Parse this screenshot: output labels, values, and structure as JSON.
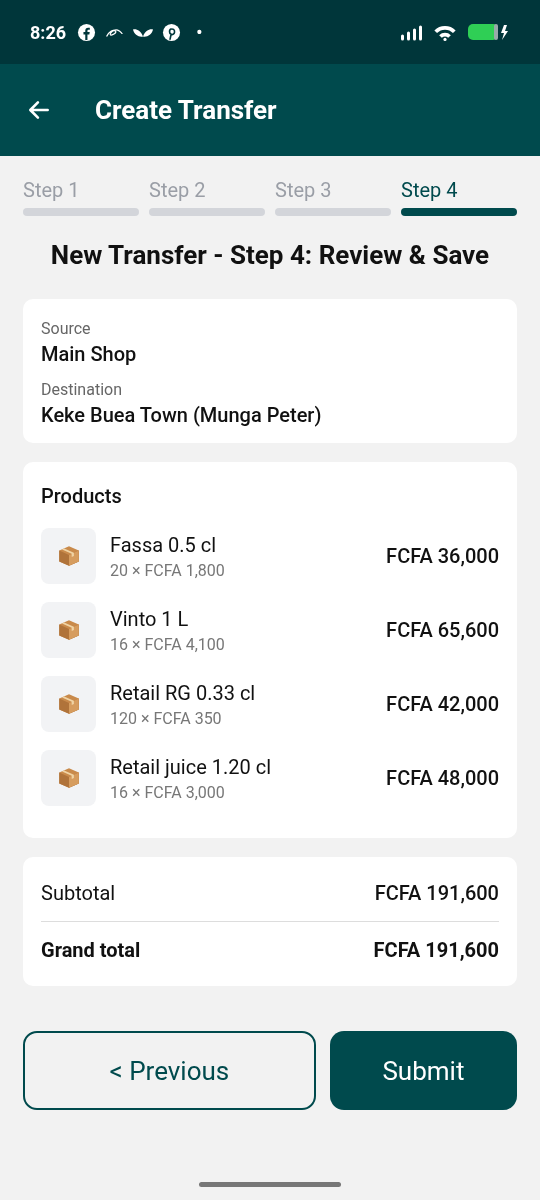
{
  "status_bar": {
    "time": "8:26",
    "notification_dot": "•"
  },
  "app_bar": {
    "title": "Create Transfer"
  },
  "steps": [
    {
      "label": "Step 1",
      "selected": false
    },
    {
      "label": "Step 2",
      "selected": false
    },
    {
      "label": "Step 3",
      "selected": false
    },
    {
      "label": "Step 4",
      "selected": true
    }
  ],
  "heading": "New Transfer - Step 4: Review & Save",
  "route": [
    {
      "label": "Source",
      "value": "Main Shop"
    },
    {
      "label": "Destination",
      "value": "Keke Buea Town (Munga Peter)"
    }
  ],
  "products": {
    "title": "Products",
    "items": [
      {
        "name": "Fassa 0.5 cl",
        "detail": "20 × FCFA 1,800",
        "total": "FCFA 36,000"
      },
      {
        "name": "Vinto 1 L",
        "detail": "16 × FCFA 4,100",
        "total": "FCFA 65,600"
      },
      {
        "name": "Retail RG 0.33 cl",
        "detail": "120 × FCFA 350",
        "total": "FCFA 42,000"
      },
      {
        "name": "Retail juice 1.20 cl",
        "detail": "16 × FCFA 3,000",
        "total": "FCFA 48,000"
      }
    ]
  },
  "totals": [
    {
      "kind": "sub",
      "label": "Subtotal",
      "value": "FCFA 191,600"
    },
    {
      "kind": "grand",
      "label": "Grand total",
      "value": "FCFA 191,600"
    }
  ],
  "buttons": {
    "previous": "< Previous",
    "submit": "Submit"
  }
}
